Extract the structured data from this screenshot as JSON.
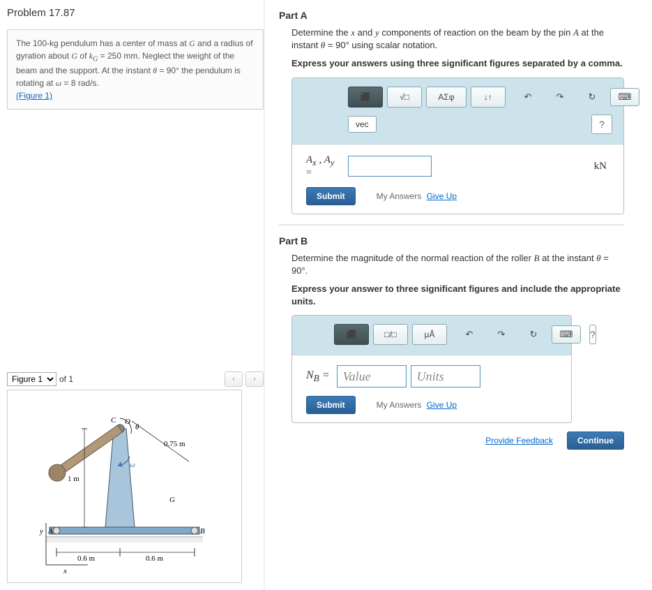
{
  "problem": {
    "title": "Problem 17.87",
    "statement_html": "The 100-kg pendulum has a center of mass at <i>G</i> and a radius of gyration about <i>G</i> of <i>k<sub>G</sub></i> = 250 mm. Neglect the weight of the beam and the support. At the instant <i>θ</i> = 90° the pendulum is rotating at <i>ω</i> = 8 rad/s.",
    "figure_link": "(Figure 1)"
  },
  "figure": {
    "selector": "Figure 1",
    "count_text": "of 1",
    "nav_prev": "‹",
    "nav_next": "›",
    "labels": {
      "C": "C",
      "O": "O",
      "G": "G",
      "A": "A",
      "B": "B",
      "y": "y",
      "x": "x",
      "theta": "θ",
      "omega": "ω",
      "h": "1 m",
      "arm": "0.75 m",
      "left_base": "0.6 m",
      "right_base": "0.6 m"
    }
  },
  "partA": {
    "label": "Part A",
    "prompt_html": "Determine the <i>x</i> and <i>y</i> components of reaction on the beam by the pin <i>A</i> at the instant <i>θ</i> = 90° using scalar notation.",
    "instruction": "Express your answers using three significant figures separated by a comma.",
    "toolbar": {
      "templates": "⬛",
      "sqrt": "√□",
      "greek": "ΑΣφ",
      "updown": "↓↑",
      "undo": "↶",
      "redo": "↷",
      "reset": "↻",
      "keyboard": "⌨",
      "vec": "vec",
      "help": "?"
    },
    "eq_label_html": "<i>A<sub>x</sub></i> , <i>A<sub>y</sub></i>",
    "eq_sign": "=",
    "unit": "kN",
    "submit": "Submit",
    "answers_label": "My Answers",
    "giveup": "Give Up"
  },
  "partB": {
    "label": "Part B",
    "prompt_html": "Determine the magnitude of the normal reaction of the roller <i>B</i> at the instant <i>θ</i> = 90°.",
    "instruction": "Express your answer to three significant figures and include the appropriate units.",
    "toolbar": {
      "templates": "⬛",
      "frac": "□/□",
      "units": "μÅ",
      "undo": "↶",
      "redo": "↷",
      "reset": "↻",
      "keyboard": "⌨",
      "help": "?"
    },
    "eq_label_html": "<i>N<sub>B</sub></i> =",
    "value_placeholder": "Value",
    "units_placeholder": "Units",
    "submit": "Submit",
    "answers_label": "My Answers",
    "giveup": "Give Up"
  },
  "footer": {
    "feedback": "Provide Feedback",
    "continue": "Continue"
  }
}
